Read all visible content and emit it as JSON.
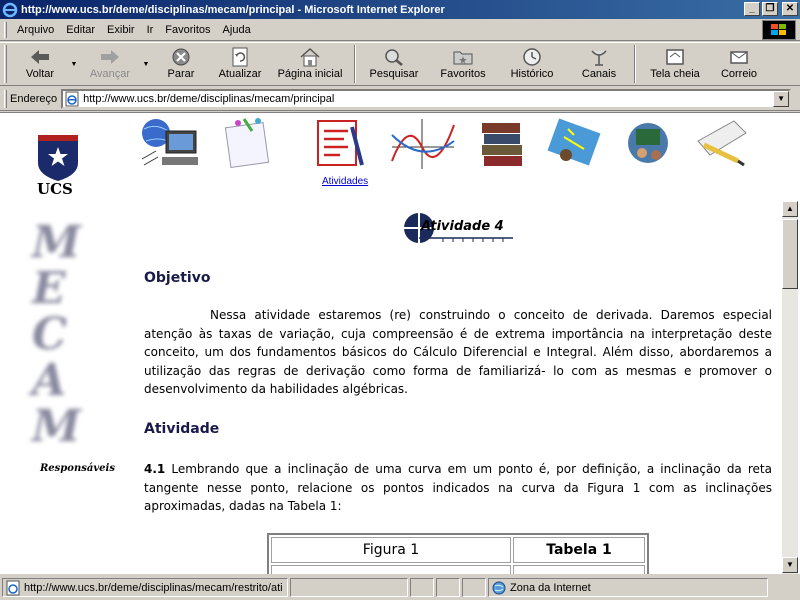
{
  "window": {
    "title": "http://www.ucs.br/deme/disciplinas/mecam/principal - Microsoft Internet Explorer",
    "buttons": [
      "_",
      "❐",
      "✕"
    ]
  },
  "menu": {
    "items": [
      "Arquivo",
      "Editar",
      "Exibir",
      "Ir",
      "Favoritos",
      "Ajuda"
    ]
  },
  "toolbar": {
    "back": "Voltar",
    "forward": "Avançar",
    "stop": "Parar",
    "refresh": "Atualizar",
    "home": "Página inicial",
    "search": "Pesquisar",
    "favorites": "Favoritos",
    "history": "Histórico",
    "channels": "Canais",
    "fullscreen": "Tela cheia",
    "mail": "Correio"
  },
  "address": {
    "label": "Endereço",
    "url": "http://www.ucs.br/deme/disciplinas/mecam/principal"
  },
  "page": {
    "logo_text": "UCS",
    "nav_link": "Atividades",
    "side_letters": [
      "M",
      "E",
      "C",
      "A",
      "M"
    ],
    "responsaveis": "Responsáveis",
    "activity_title": "Atividade 4",
    "objetivo_heading": "Objetivo",
    "objetivo_text": "Nessa atividade estaremos (re) construindo o conceito de derivada. Daremos especial atenção às taxas de variação, cuja compreensão é de extrema importância na interpretação deste conceito, um dos fundamentos básicos do Cálculo Diferencial e Integral. Além disso, abordaremos a utilização das regras de derivação como forma de familiarizá- lo com as mesmas e promover o desenvolvimento da habilidades algébricas.",
    "atividade_heading": "Atividade",
    "item_number": "4.1",
    "item_text": "Lembrando que a inclinação de uma curva em um ponto é, por definição, a inclinação da reta tangente nesse ponto, relacione os pontos indicados na curva da Figura 1 com as inclinações aproximadas, dadas na Tabela 1:",
    "table": {
      "col1": "Figura 1",
      "col2": "Tabela 1"
    }
  },
  "status": {
    "url": "http://www.ucs.br/deme/disciplinas/mecam/restrito/ati",
    "zone": "Zona da Internet"
  }
}
